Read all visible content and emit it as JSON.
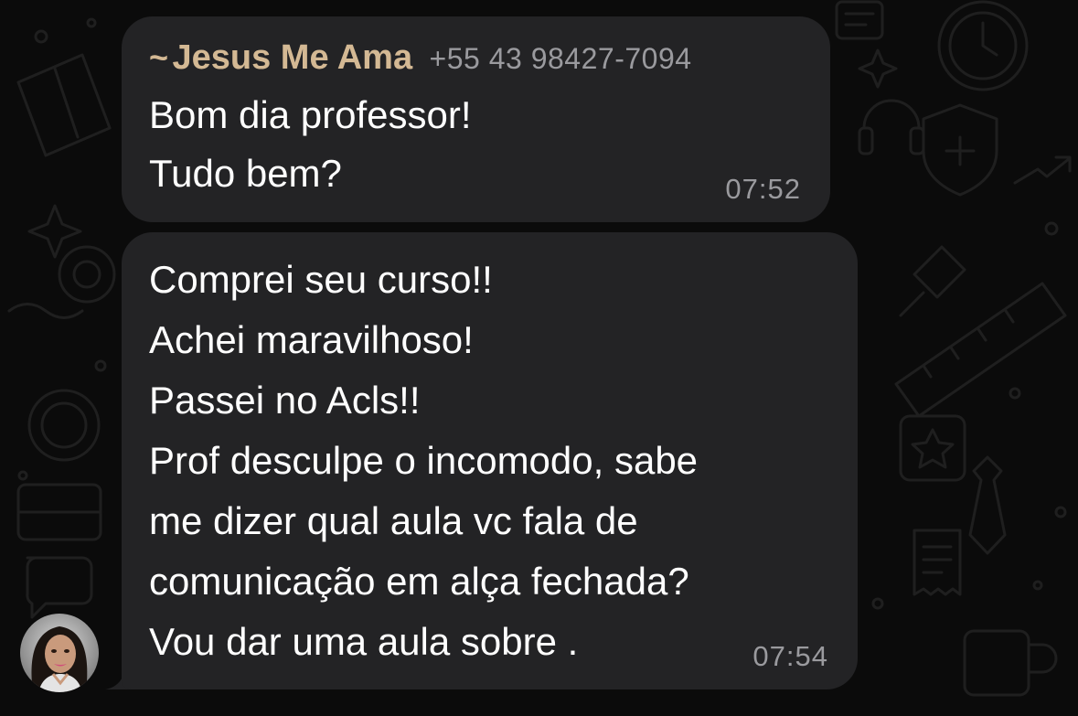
{
  "chat": {
    "message1": {
      "sender_prefix": "~",
      "sender_name": "Jesus Me Ama",
      "sender_phone": "+55 43 98427-7094",
      "lines": [
        "Bom dia professor!",
        "Tudo bem?"
      ],
      "time": "07:52"
    },
    "message2": {
      "lines": [
        "Comprei seu curso!!",
        "Achei maravilhoso!",
        "Passei no Acls!!",
        "Prof desculpe o incomodo, sabe",
        "me dizer qual aula vc fala de",
        "comunicação em alça fechada?",
        "Vou dar uma aula sobre ."
      ],
      "time": "07:54"
    }
  },
  "colors": {
    "background": "#0b0b0b",
    "bubble": "#232325",
    "sender_name": "#d4b994",
    "meta_text": "#9a9a9e"
  },
  "icons": [
    "avatar-photo",
    "wallpaper-doodle-icons"
  ]
}
